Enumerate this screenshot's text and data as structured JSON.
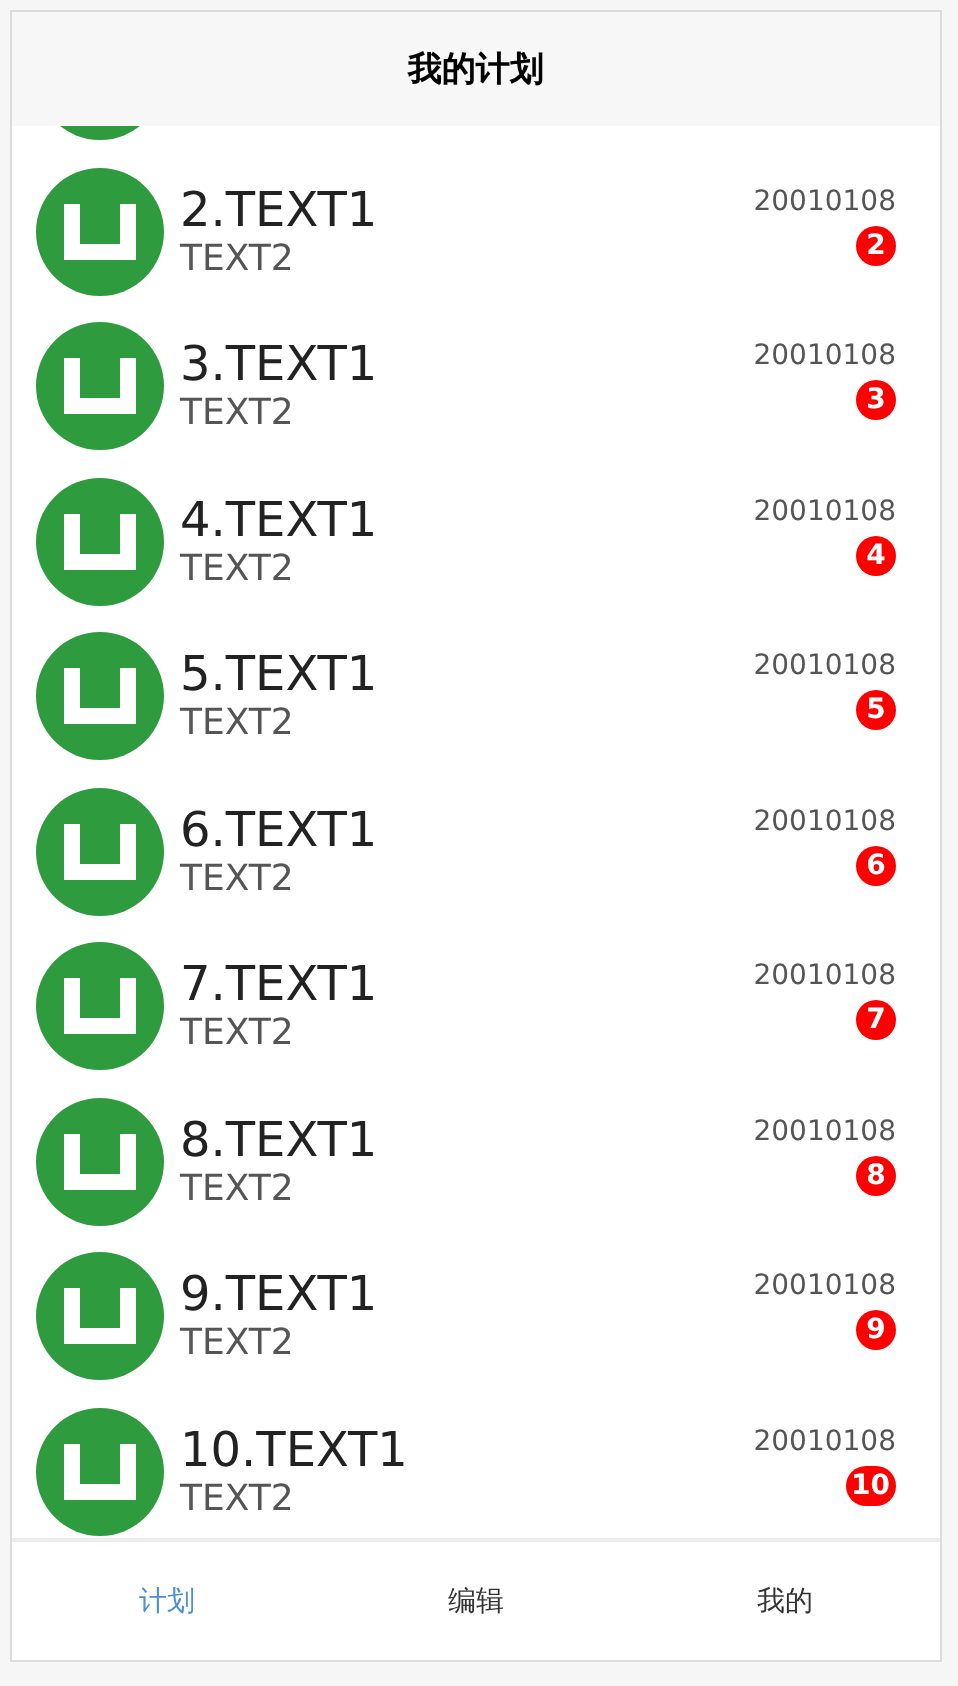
{
  "header": {
    "title": "我的计划"
  },
  "items": [
    {
      "kind": "partial"
    },
    {
      "kind": "full",
      "title": "2.TEXT1",
      "subtitle": "TEXT2",
      "date": "20010108",
      "badge": "2"
    },
    {
      "kind": "full",
      "title": "3.TEXT1",
      "subtitle": "TEXT2",
      "date": "20010108",
      "badge": "3"
    },
    {
      "kind": "full",
      "title": "4.TEXT1",
      "subtitle": "TEXT2",
      "date": "20010108",
      "badge": "4"
    },
    {
      "kind": "full",
      "title": "5.TEXT1",
      "subtitle": "TEXT2",
      "date": "20010108",
      "badge": "5"
    },
    {
      "kind": "full",
      "title": "6.TEXT1",
      "subtitle": "TEXT2",
      "date": "20010108",
      "badge": "6"
    },
    {
      "kind": "full",
      "title": "7.TEXT1",
      "subtitle": "TEXT2",
      "date": "20010108",
      "badge": "7"
    },
    {
      "kind": "full",
      "title": "8.TEXT1",
      "subtitle": "TEXT2",
      "date": "20010108",
      "badge": "8"
    },
    {
      "kind": "full",
      "title": "9.TEXT1",
      "subtitle": "TEXT2",
      "date": "20010108",
      "badge": "9"
    },
    {
      "kind": "full",
      "title": "10.TEXT1",
      "subtitle": "TEXT2",
      "date": "20010108",
      "badge": "10"
    }
  ],
  "tabs": [
    {
      "label": "计划",
      "selected": true
    },
    {
      "label": "编辑",
      "selected": false
    },
    {
      "label": "我的",
      "selected": false
    }
  ]
}
